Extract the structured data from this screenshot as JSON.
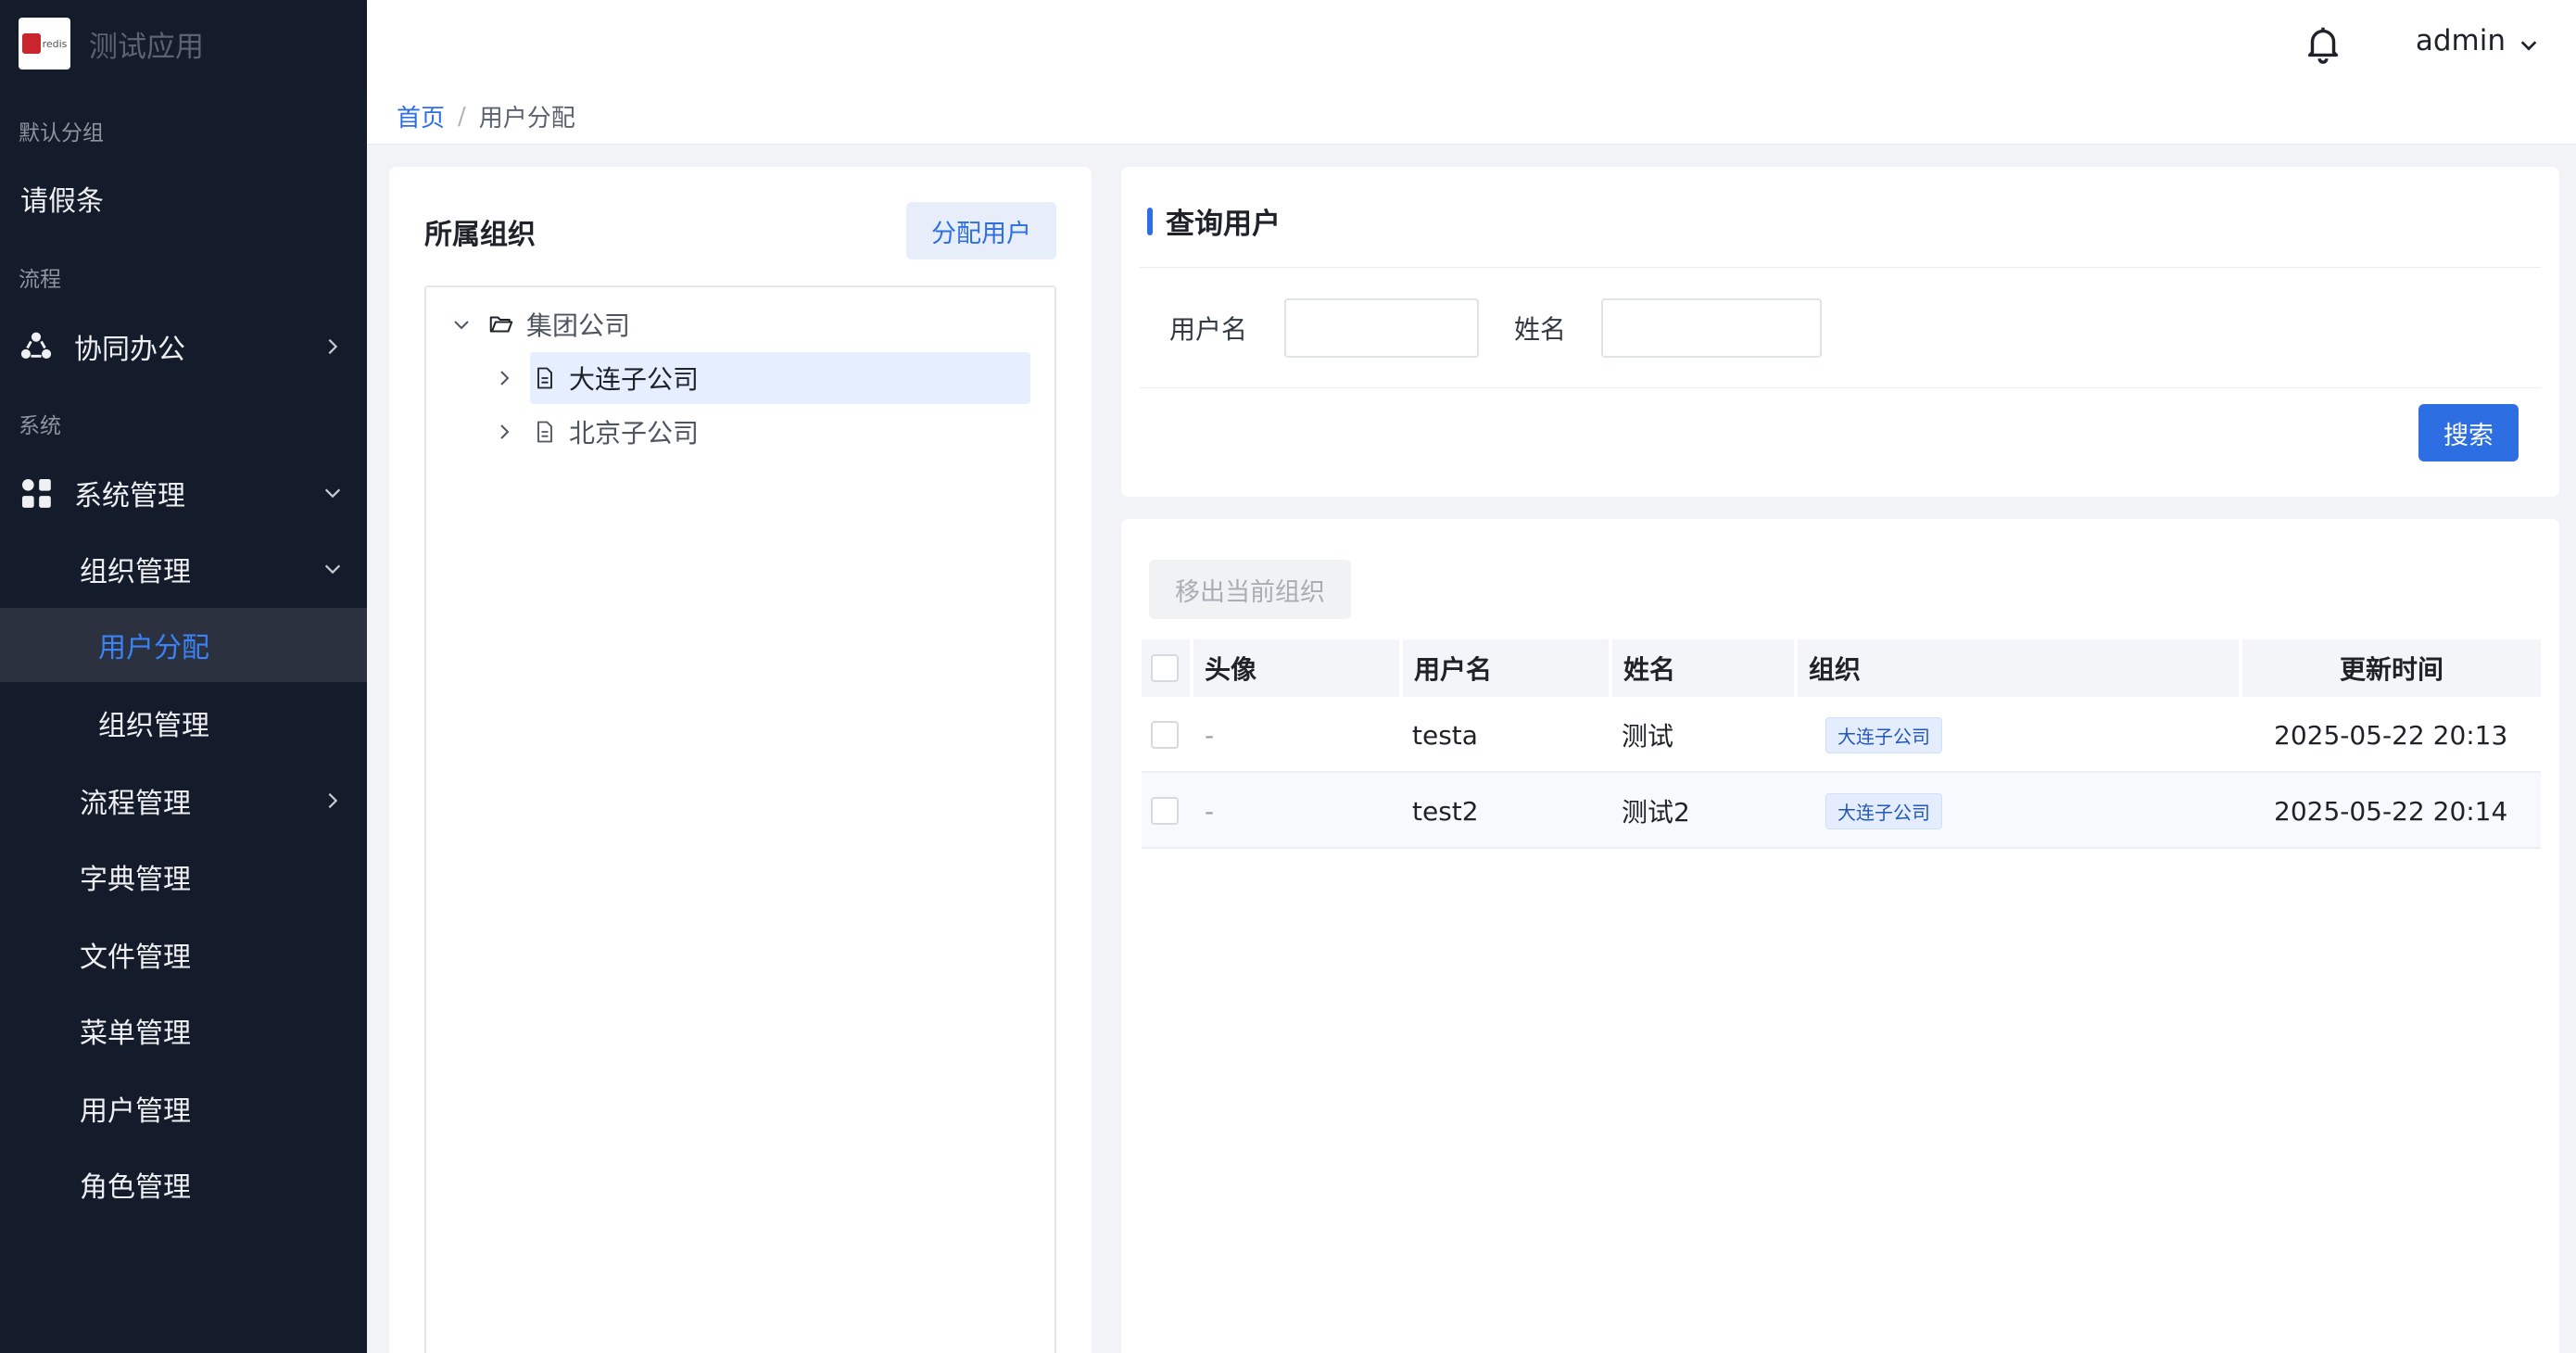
{
  "app": {
    "title": "测试应用",
    "logo_text": "redis"
  },
  "sidebar": {
    "groups": [
      "默认分组",
      "流程",
      "系统"
    ],
    "items": {
      "leave": "请假条",
      "collab": "协同办公",
      "sys_mgmt": "系统管理",
      "org_mgmt": "组织管理",
      "user_assign": "用户分配",
      "org_mgmt_sub": "组织管理",
      "flow_mgmt": "流程管理",
      "dict_mgmt": "字典管理",
      "file_mgmt": "文件管理",
      "menu_mgmt": "菜单管理",
      "user_mgmt": "用户管理",
      "role_mgmt": "角色管理"
    }
  },
  "header": {
    "user": "admin"
  },
  "breadcrumb": {
    "home": "首页",
    "sep": "/",
    "current": "用户分配"
  },
  "org_panel": {
    "title": "所属组织",
    "assign_button": "分配用户",
    "tree": {
      "root": "集团公司",
      "children": [
        "大连子公司",
        "北京子公司"
      ]
    }
  },
  "query": {
    "title": "查询用户",
    "username_label": "用户名",
    "username_value": "",
    "name_label": "姓名",
    "name_value": "",
    "search_button": "搜索"
  },
  "table": {
    "remove_button": "移出当前组织",
    "columns": [
      "头像",
      "用户名",
      "姓名",
      "组织",
      "更新时间"
    ],
    "rows": [
      {
        "avatar": "-",
        "username": "testa",
        "name": "测试",
        "org": "大连子公司",
        "updated": "2025-05-22 20:13"
      },
      {
        "avatar": "-",
        "username": "test2",
        "name": "测试2",
        "org": "大连子公司",
        "updated": "2025-05-22 20:14"
      }
    ]
  },
  "colors": {
    "accent": "#2d6fe3",
    "sidebar_bg": "#141b2a",
    "active_bg": "#2b313e"
  }
}
